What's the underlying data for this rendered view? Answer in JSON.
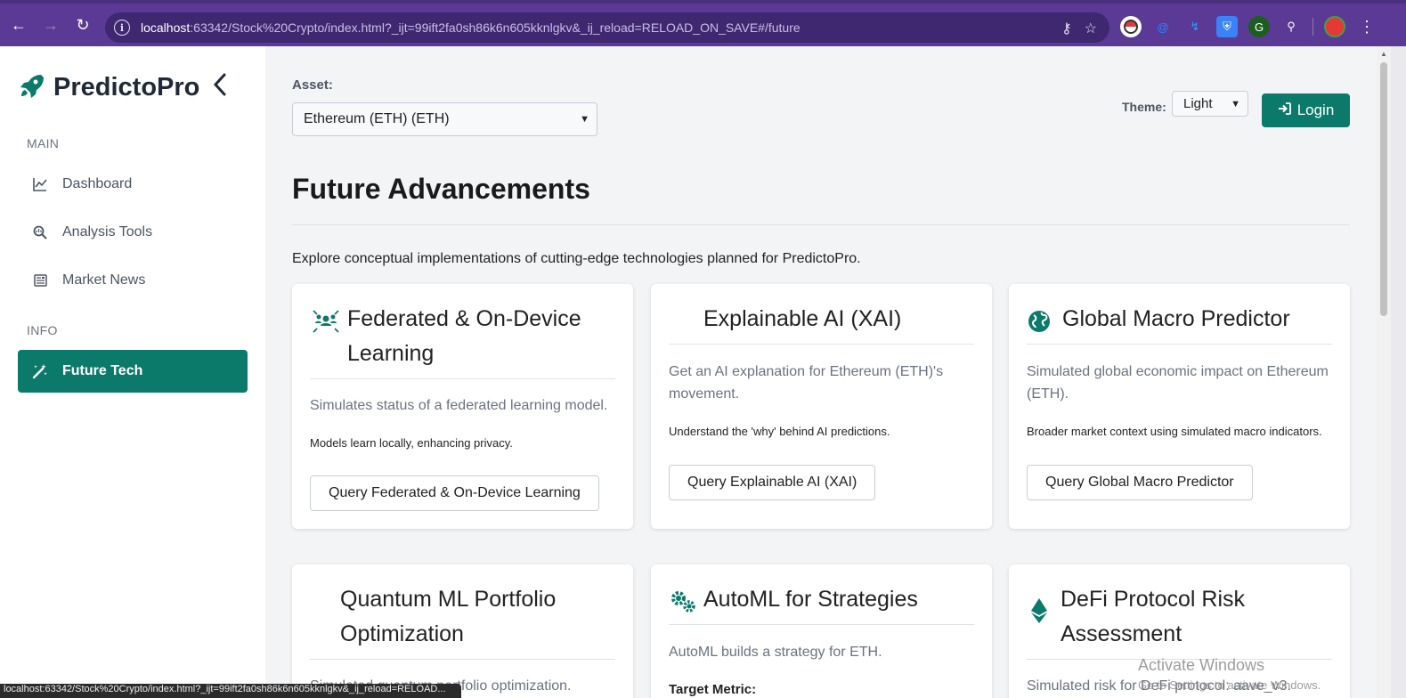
{
  "browser": {
    "url_host": "localhost",
    "url_rest": ":63342/Stock%20Crypto/index.html?_ijt=99ift2fa0sh86k6n605kknlgkv&_ij_reload=RELOAD_ON_SAVE#/future",
    "status_text": "localhost:63342/Stock%20Crypto/index.html?_ijt=99ift2fa0sh86k6n605kknlgkv&_ij_reload=RELOAD..."
  },
  "sidebar": {
    "brand": "PredictoPro",
    "sections": {
      "main_label": "MAIN",
      "info_label": "INFO"
    },
    "items": [
      {
        "label": "Dashboard",
        "icon": "chart-line-icon"
      },
      {
        "label": "Analysis Tools",
        "icon": "search-chart-icon"
      },
      {
        "label": "Market News",
        "icon": "newspaper-icon"
      },
      {
        "label": "Future Tech",
        "icon": "magic-wand-icon",
        "active": true
      }
    ]
  },
  "header": {
    "asset_label": "Asset:",
    "asset_value": "Ethereum (ETH) (ETH)",
    "theme_label": "Theme:",
    "theme_value": "Light",
    "login_label": "Login"
  },
  "page": {
    "title": "Future Advancements",
    "intro": "Explore conceptual implementations of cutting-edge technologies planned for PredictoPro."
  },
  "cards": [
    {
      "title": "Federated & On-Device Learning",
      "desc": "Simulates status of a federated learning model.",
      "note": "Models learn locally, enhancing privacy.",
      "button": "Query Federated & On-Device Learning"
    },
    {
      "title": "Explainable AI (XAI)",
      "desc": "Get an AI explanation for Ethereum (ETH)'s movement.",
      "note": "Understand the 'why' behind AI predictions.",
      "button": "Query Explainable AI (XAI)"
    },
    {
      "title": "Global Macro Predictor",
      "desc": "Simulated global economic impact on Ethereum (ETH).",
      "note": "Broader market context using simulated macro indicators.",
      "button": "Query Global Macro Predictor"
    },
    {
      "title": "Quantum ML Portfolio Optimization",
      "desc": "Simulated quantum portfolio optimization."
    },
    {
      "title": "AutoML for Strategies",
      "desc": "AutoML builds a strategy for ETH.",
      "label": "Target Metric:"
    },
    {
      "title": "DeFi Protocol Risk Assessment",
      "desc": "Simulated risk for DeFi protocol: aave_v3."
    }
  ],
  "watermark": {
    "title": "Activate Windows",
    "sub": "Go to Settings to activate Windows."
  },
  "colors": {
    "accent": "#0c7a6a",
    "browser_frame": "#5a3a94"
  }
}
